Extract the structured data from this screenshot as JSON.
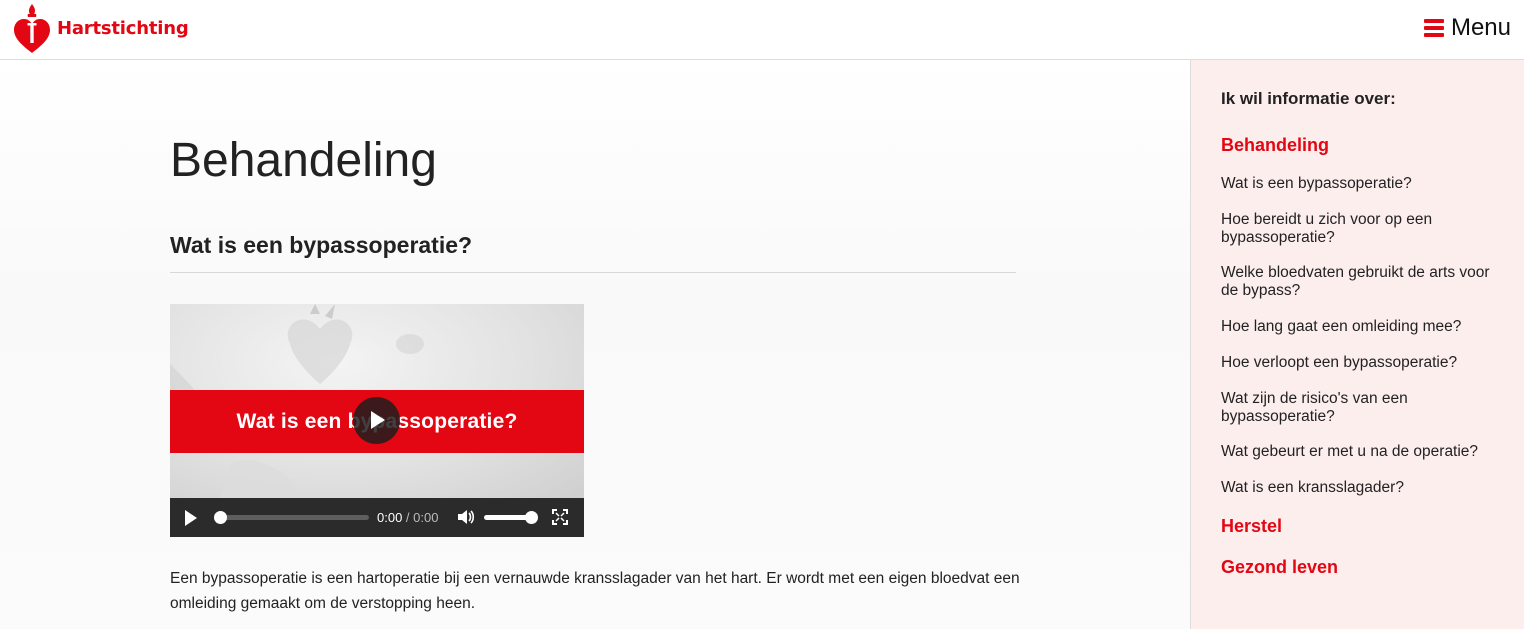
{
  "header": {
    "logo_text": "Hartstichting",
    "menu_label": "Menu"
  },
  "main": {
    "page_title": "Behandeling",
    "section_title": "Wat is een bypassoperatie?",
    "video": {
      "banner_text": "Wat is een bypassoperatie?",
      "current_time": "0:00",
      "separator": " / ",
      "duration": "0:00"
    },
    "paragraph": "Een bypassoperatie is een hartoperatie bij een vernauwde kransslagader van het hart. Er wordt met een eigen bloedvat een omleiding gemaakt om de verstopping heen."
  },
  "sidebar": {
    "heading": "Ik wil informatie over:",
    "categories": [
      "Behandeling",
      "Herstel",
      "Gezond leven"
    ],
    "links": [
      "Wat is een bypassoperatie?",
      "Hoe bereidt u zich voor op een bypassoperatie?",
      "Welke bloedvaten gebruikt de arts voor de bypass?",
      "Hoe lang gaat een omleiding mee?",
      "Hoe verloopt een bypassoperatie?",
      "Wat zijn de risico's van een bypassoperatie?",
      "Wat gebeurt er met u na de operatie?",
      "Wat is een kransslagader?"
    ]
  },
  "colors": {
    "brand_red": "#e30613",
    "sidebar_bg": "#fdeeee",
    "video_controls": "#2b2b2b"
  },
  "icons": [
    "heart-torch-logo-icon",
    "hamburger-icon",
    "play-icon",
    "volume-icon",
    "fullscreen-icon"
  ]
}
